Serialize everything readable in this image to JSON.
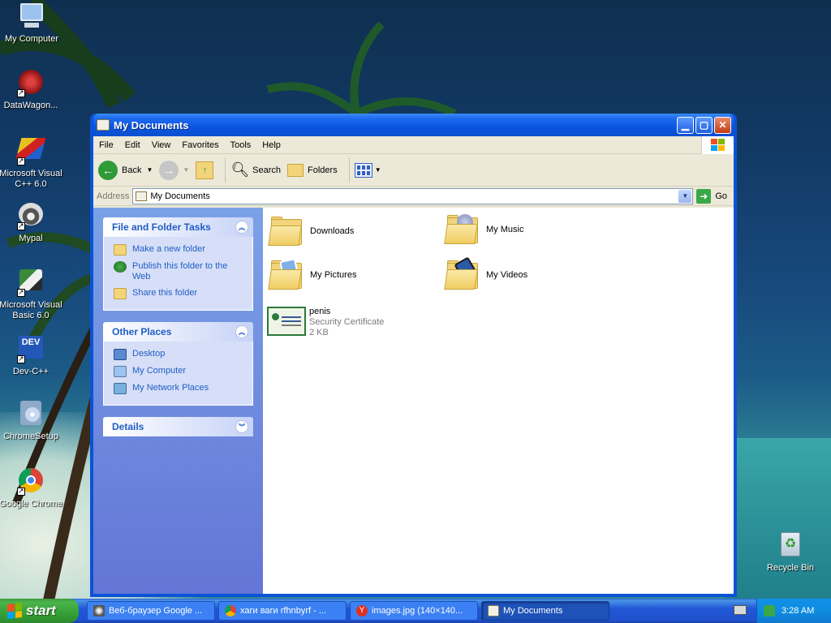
{
  "desktop": {
    "icons": [
      {
        "label": "My Computer"
      },
      {
        "label": "DataWagon..."
      },
      {
        "label": "Microsoft Visual C++ 6.0"
      },
      {
        "label": "Mypal"
      },
      {
        "label": "Microsoft Visual Basic 6.0"
      },
      {
        "label": "Dev-C++"
      },
      {
        "label": "ChromeSetup"
      },
      {
        "label": "Google Chrome"
      },
      {
        "label": "Recycle Bin"
      }
    ]
  },
  "window": {
    "title": "My Documents",
    "menu": [
      "File",
      "Edit",
      "View",
      "Favorites",
      "Tools",
      "Help"
    ],
    "toolbar": {
      "back": "Back",
      "search": "Search",
      "folders": "Folders"
    },
    "address": {
      "label": "Address",
      "value": "My Documents",
      "go": "Go"
    },
    "taskpane": {
      "file_tasks": {
        "title": "File and Folder Tasks",
        "items": [
          "Make a new folder",
          "Publish this folder to the Web",
          "Share this folder"
        ]
      },
      "other_places": {
        "title": "Other Places",
        "items": [
          "Desktop",
          "My Computer",
          "My Network Places"
        ]
      },
      "details": {
        "title": "Details"
      }
    },
    "files": [
      {
        "name": "Downloads"
      },
      {
        "name": "My Music"
      },
      {
        "name": "My Pictures"
      },
      {
        "name": "My Videos"
      },
      {
        "name": "penis",
        "type": "Security Certificate",
        "size": "2 KB"
      }
    ]
  },
  "taskbar": {
    "start": "start",
    "tasks": [
      {
        "label": "Веб-браузер Google ..."
      },
      {
        "label": "хаги ваги rfhnbyrf - ..."
      },
      {
        "label": "images.jpg (140×140..."
      },
      {
        "label": "My Documents"
      }
    ],
    "clock": "3:28 AM"
  },
  "colors": {
    "xp_blue": "#0a53d6",
    "taskpane_link": "#215dc6",
    "start_green": "#3c9a3c"
  }
}
